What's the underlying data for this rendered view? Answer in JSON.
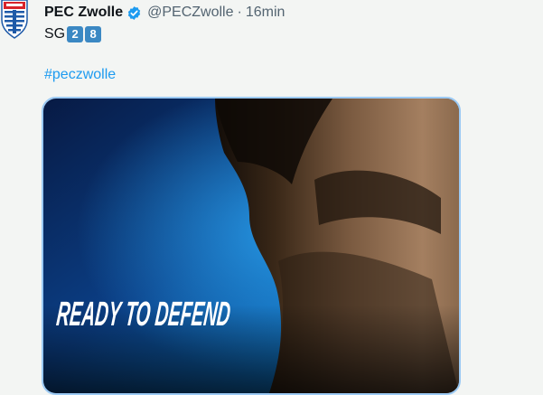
{
  "tweet": {
    "author_name": "PEC Zwolle",
    "handle": "@PECZwolle",
    "separator": "·",
    "time": "16min",
    "text_prefix": "SG",
    "number_keys": [
      "2",
      "8"
    ],
    "hashtag": "#peczwolle",
    "avatar_icon": "pec-zwolle-crest-icon",
    "verified_icon": "verified-badge-icon",
    "media": {
      "caption": "READY TO DEFEND"
    }
  },
  "colors": {
    "background": "#f3f5f3",
    "link": "#1d9bf0",
    "verified": "#1d9bf0",
    "keycap": "#3b88c3",
    "media_border": "#9ccaf4"
  }
}
